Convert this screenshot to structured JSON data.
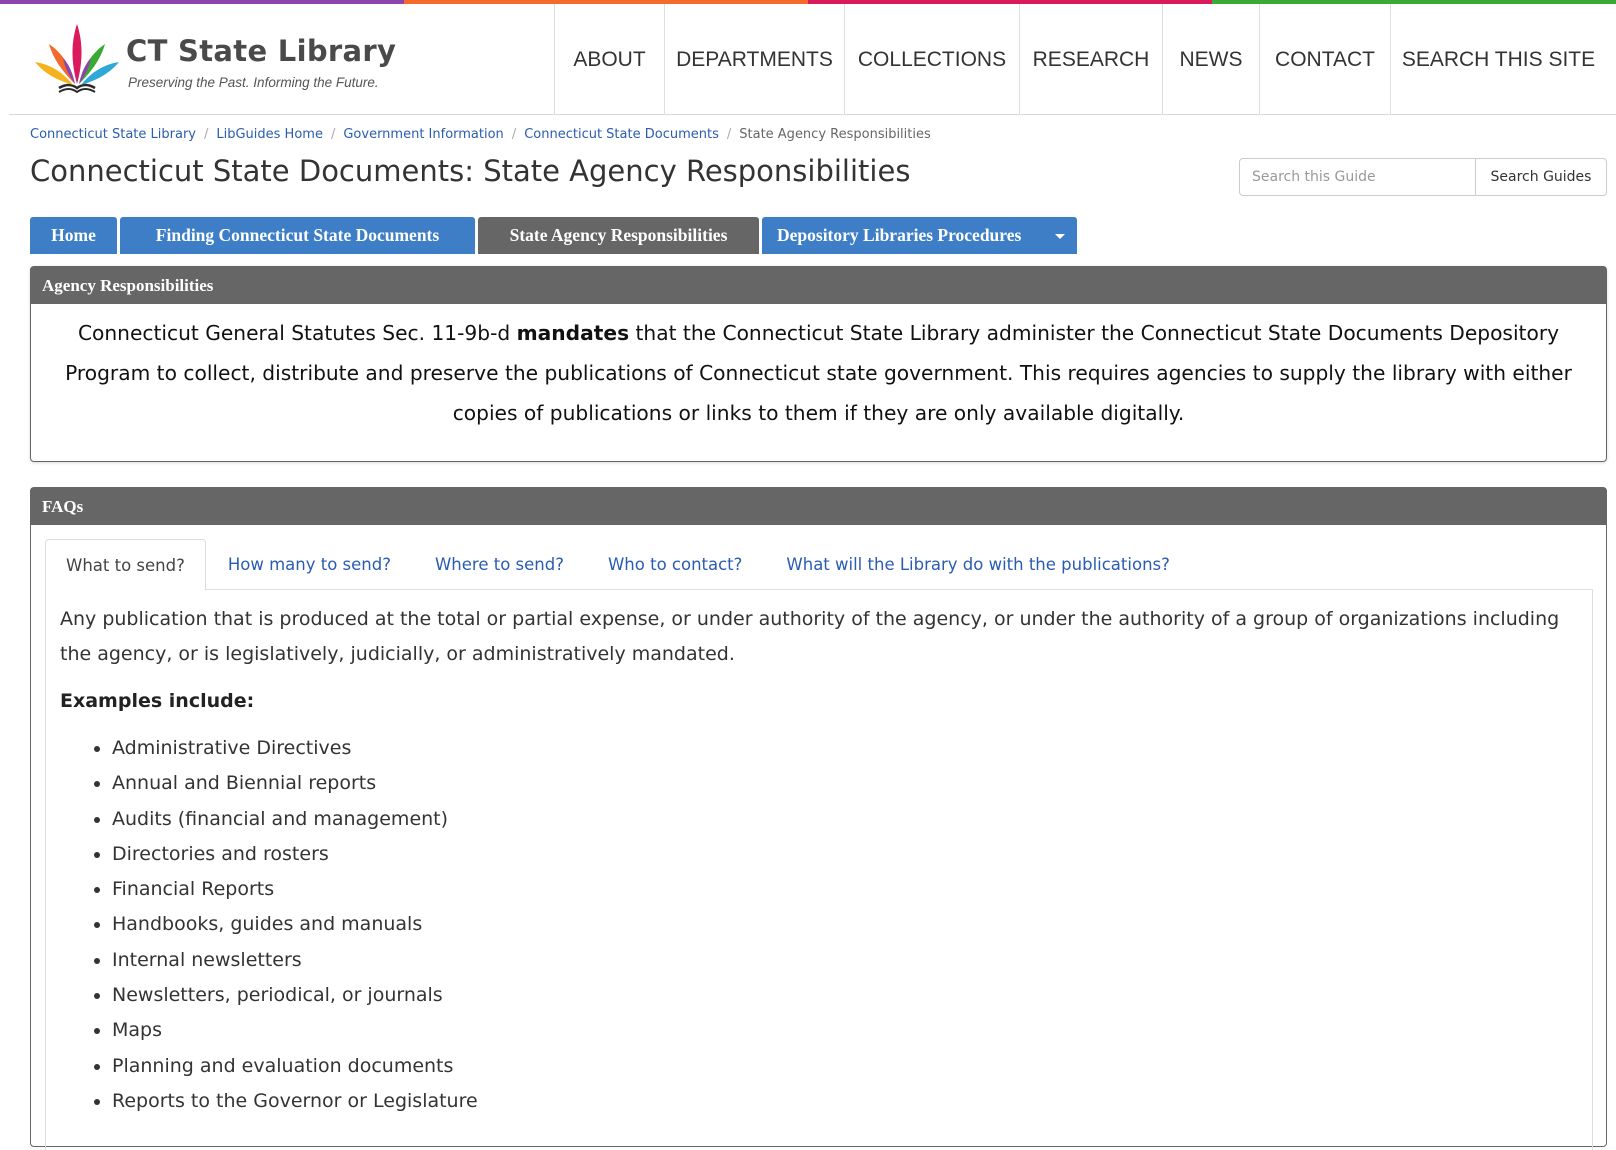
{
  "header": {
    "stripe_colors": [
      "#8e44ad",
      "#f26b2a",
      "#d91a5c",
      "#3aaa35"
    ],
    "logo": {
      "name": "CT State Library",
      "tagline": "Preserving the Past. Informing the Future."
    },
    "nav": [
      {
        "label": "ABOUT"
      },
      {
        "label": "DEPARTMENTS"
      },
      {
        "label": "COLLECTIONS"
      },
      {
        "label": "RESEARCH"
      },
      {
        "label": "NEWS"
      },
      {
        "label": "CONTACT"
      },
      {
        "label": "SEARCH THIS SITE"
      }
    ]
  },
  "breadcrumb": {
    "links": [
      {
        "label": "Connecticut State Library"
      },
      {
        "label": "LibGuides Home"
      },
      {
        "label": "Government Information"
      },
      {
        "label": "Connecticut State Documents"
      }
    ],
    "current": "State Agency Responsibilities"
  },
  "page": {
    "title": "Connecticut State Documents: State Agency Responsibilities"
  },
  "search": {
    "placeholder": "Search this Guide",
    "button_label": "Search Guides"
  },
  "guide_tabs": [
    {
      "label": "Home",
      "active": false
    },
    {
      "label": "Finding Connecticut State Documents",
      "active": false
    },
    {
      "label": "State Agency Responsibilities",
      "active": true
    },
    {
      "label": "Depository Libraries Procedures",
      "active": false,
      "has_dropdown": true
    }
  ],
  "colors": {
    "tab_blue": "#3d7ec7",
    "tab_active": "#666666",
    "link_blue": "#2a5db0",
    "box_heading": "#666666"
  },
  "agency_box": {
    "heading": "Agency Responsibilities",
    "text_before": "Connecticut General Statutes Sec. 11-9b-d ",
    "text_bold": "mandates",
    "text_after": " that the Connecticut State Library administer the Connecticut State Documents Depository Program to collect, distribute and preserve the publications of Connecticut state government. This requires agencies to supply the library with either copies of publications or links to them if they are only available digitally."
  },
  "faq_box": {
    "heading": "FAQs",
    "tabs": [
      {
        "label": "What to send?",
        "active": true
      },
      {
        "label": "How many to send?",
        "active": false
      },
      {
        "label": "Where to send?",
        "active": false
      },
      {
        "label": "Who to contact?",
        "active": false
      },
      {
        "label": "What will the Library do with the publications?",
        "active": false
      }
    ],
    "panel": {
      "intro": "Any publication that is produced at the total or partial expense, or under authority of the agency, or under the authority of a group of organizations including the agency, or is legislatively, judicially, or administratively mandated.",
      "examples_heading": "Examples include:",
      "examples": [
        "Administrative Directives",
        "Annual and Biennial reports",
        "Audits (financial and management)",
        "Directories and rosters",
        "Financial Reports",
        "Handbooks, guides and manuals",
        "Internal newsletters",
        "Newsletters, periodical, or journals",
        "Maps",
        "Planning and evaluation documents",
        "Reports to the Governor or Legislature"
      ]
    }
  }
}
